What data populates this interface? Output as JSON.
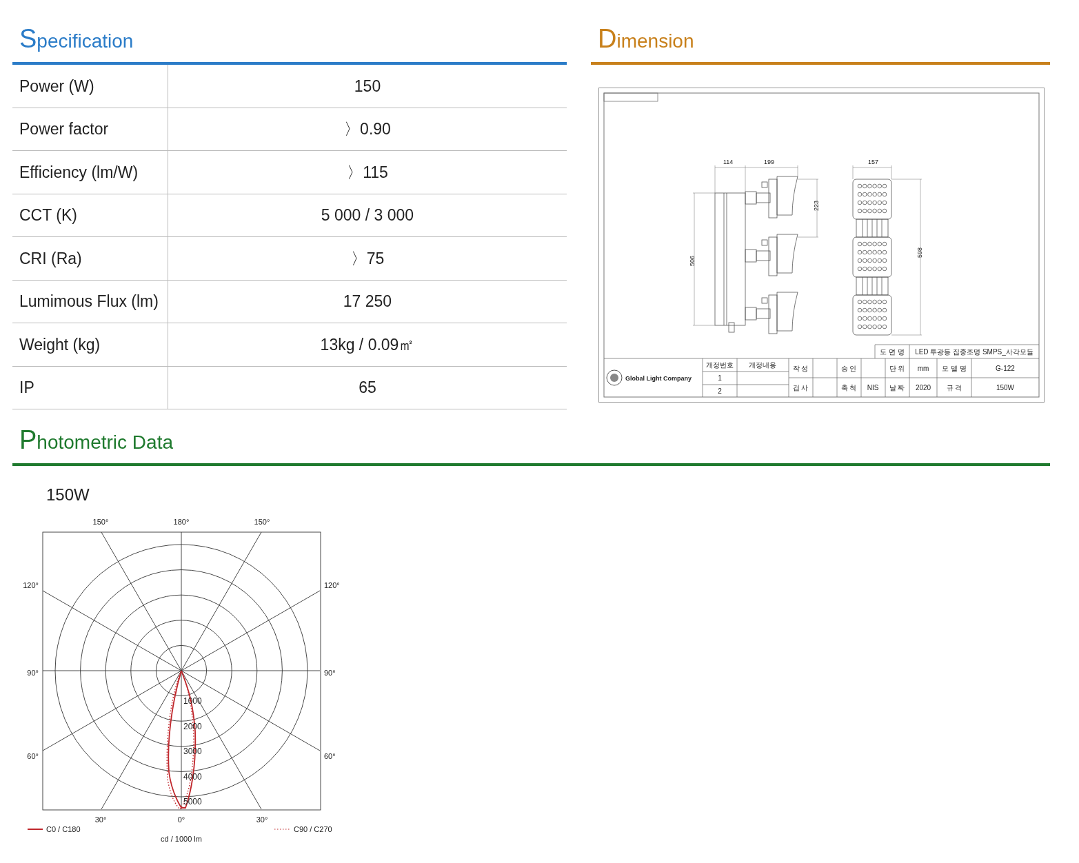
{
  "specification": {
    "title": "Specification",
    "rows": [
      {
        "label": "Power (W)",
        "value": "150"
      },
      {
        "label": "Power factor",
        "value": "〉0.90"
      },
      {
        "label": "Efficiency (lm/W)",
        "value": "〉115"
      },
      {
        "label": "CCT (K)",
        "value": "5 000 / 3 000"
      },
      {
        "label": "CRI (Ra)",
        "value": "〉75"
      },
      {
        "label": "Lumimous Flux (lm)",
        "value": "17 250"
      },
      {
        "label": "Weight (kg)",
        "value": "13kg / 0.09㎡"
      },
      {
        "label": "IP",
        "value": "65"
      }
    ]
  },
  "dimension": {
    "title": "Dimension",
    "dims": [
      "114",
      "199",
      "223",
      "506",
      "157",
      "598"
    ],
    "title_block": {
      "company": "Global Light Company",
      "rev_no": "개정번호",
      "rev_content": "개정내용",
      "revs": [
        "1",
        "2"
      ],
      "drawn": "작 성",
      "checked": "검 사",
      "approved": "승 인",
      "scale": "축 척",
      "scale_value": "NIS",
      "unit": "단 위",
      "unit_value": "mm",
      "date": "날 짜",
      "date_value": "2020",
      "drawing_name_label": "도 면 명",
      "drawing_name": "LED 투광등 집중조명 SMPS_사각모듈",
      "model_label": "모 델 명",
      "model": "G-122",
      "spec_label": "규 격",
      "spec": "150W"
    }
  },
  "photometric": {
    "title": "Photometric Data",
    "subtitle": "150W",
    "angle_labels_top": [
      "150°",
      "180°",
      "150°"
    ],
    "angle_labels_left": [
      "120°",
      "90°",
      "60°"
    ],
    "angle_labels_right": [
      "120°",
      "90°",
      "60°"
    ],
    "angle_labels_bottom": [
      "30°",
      "0°",
      "30°"
    ],
    "ring_labels": [
      "1000",
      "2000",
      "3000",
      "4000",
      "5000"
    ],
    "legend": [
      {
        "label": "C0 / C180",
        "kind": "solid"
      },
      {
        "label": "C90 / C270",
        "kind": "dotted"
      }
    ],
    "unit": "cd / 1000 lm"
  }
}
